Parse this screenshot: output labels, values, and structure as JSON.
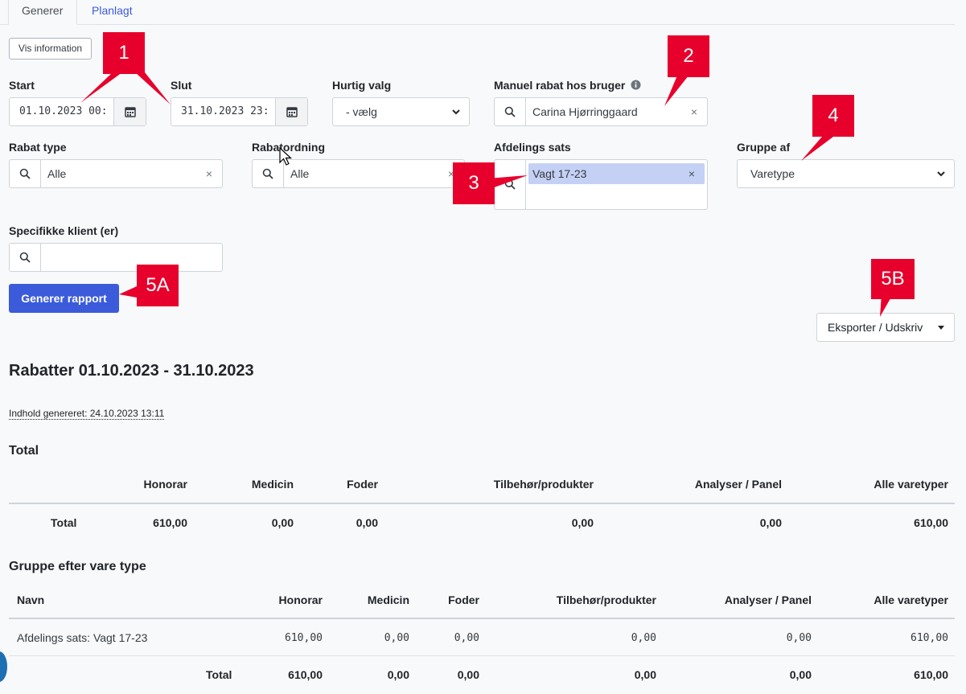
{
  "tabs": [
    {
      "label": "Generer",
      "active": true
    },
    {
      "label": "Planlagt",
      "active": false
    }
  ],
  "info_button": "Vis information",
  "filters": {
    "start": {
      "label": "Start",
      "value": "01.10.2023 00:"
    },
    "end": {
      "label": "Slut",
      "value": "31.10.2023 23:"
    },
    "quick": {
      "label": "Hurtig valg",
      "value": "- vælg"
    },
    "manual_user": {
      "label": "Manuel rabat hos bruger",
      "value": "Carina Hjørringgaard"
    },
    "rebate_type": {
      "label": "Rabat type",
      "value": "Alle"
    },
    "rebate_scheme": {
      "label": "Rabatordning",
      "value": "Alle"
    },
    "dept_rate": {
      "label": "Afdelings sats",
      "chip": "Vagt 17-23"
    },
    "group_by": {
      "label": "Gruppe af",
      "value": "Varetype"
    },
    "clients": {
      "label": "Specifikke klient (er)",
      "value": ""
    }
  },
  "generate_button": "Generer rapport",
  "export_button": "Eksporter / Udskriv",
  "report": {
    "title": "Rabatter 01.10.2023 - 31.10.2023",
    "generated": "Indhold genereret: 24.10.2023 13:11",
    "total_section": {
      "heading": "Total",
      "columns": [
        "Honorar",
        "Medicin",
        "Foder",
        "Tilbehør/produkter",
        "Analyser / Panel",
        "Alle varetyper"
      ],
      "row_label": "Total",
      "values": [
        "610,00",
        "0,00",
        "0,00",
        "0,00",
        "0,00",
        "610,00"
      ]
    },
    "group_section": {
      "heading": "Gruppe efter vare type",
      "columns": [
        "Navn",
        "Honorar",
        "Medicin",
        "Foder",
        "Tilbehør/produkter",
        "Analyser / Panel",
        "Alle varetyper"
      ],
      "rows": [
        {
          "name": "Afdelings sats: Vagt 17-23",
          "values": [
            "610,00",
            "0,00",
            "0,00",
            "0,00",
            "0,00",
            "610,00"
          ]
        }
      ],
      "total_label": "Total",
      "total_values": [
        "610,00",
        "0,00",
        "0,00",
        "0,00",
        "0,00",
        "610,00"
      ]
    }
  },
  "callouts": [
    "1",
    "2",
    "3",
    "4",
    "5A",
    "5B"
  ],
  "colors": {
    "primary": "#3b5bdb",
    "callout": "#e8002c",
    "chip": "#c5d0f5"
  }
}
